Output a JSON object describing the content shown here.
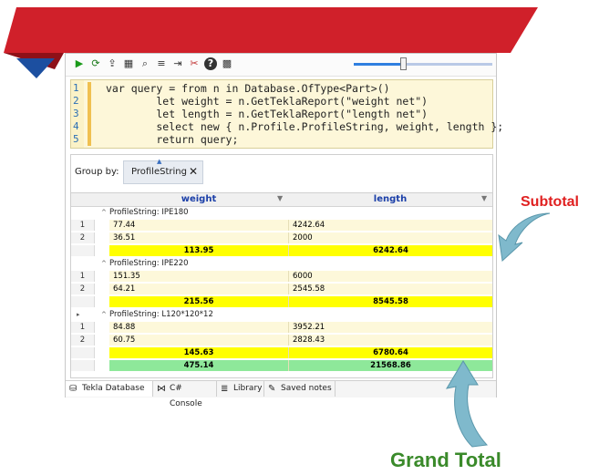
{
  "toolbar": {
    "icons": [
      "run-icon",
      "refresh-icon",
      "format-icon",
      "grid-icon",
      "connect-icon",
      "list-icon",
      "list-indent-icon",
      "clear-icon",
      "help-icon",
      "options-icon"
    ],
    "glyphs": [
      "▶",
      "⟳",
      "⇪",
      "▦",
      "⌕",
      "≡",
      "⇥",
      "✂",
      "?",
      "▩"
    ]
  },
  "editor": {
    "line_numbers": [
      "1",
      "2",
      "3",
      "4",
      "5"
    ],
    "lines": [
      "var query = from n in Database.OfType<Part>()",
      "        let weight = n.GetTeklaReport(\"weight net\")",
      "        let length = n.GetTeklaReport(\"length net\")",
      "        select new { n.Profile.ProfileString, weight, length };",
      "        return query;"
    ]
  },
  "groupby": {
    "label": "Group by:",
    "chip": "ProfileString",
    "remove": "✕"
  },
  "grid": {
    "columns": [
      "weight",
      "length"
    ],
    "groups": [
      {
        "title": "ProfileString: IPE180",
        "rows": [
          {
            "idx": "1",
            "weight": "77.44",
            "length": "4242.64"
          },
          {
            "idx": "2",
            "weight": "36.51",
            "length": "2000"
          }
        ],
        "subtotal": {
          "weight": "113.95",
          "length": "6242.64"
        }
      },
      {
        "title": "ProfileString: IPE220",
        "rows": [
          {
            "idx": "1",
            "weight": "151.35",
            "length": "6000"
          },
          {
            "idx": "2",
            "weight": "64.21",
            "length": "2545.58"
          }
        ],
        "subtotal": {
          "weight": "215.56",
          "length": "8545.58"
        }
      },
      {
        "title": "ProfileString: L120*120*12",
        "rows": [
          {
            "idx": "1",
            "weight": "84.88",
            "length": "3952.21"
          },
          {
            "idx": "2",
            "weight": "60.75",
            "length": "2828.43"
          }
        ],
        "subtotal": {
          "weight": "145.63",
          "length": "6780.64"
        }
      }
    ],
    "total": {
      "weight": "475.14",
      "length": "21568.86"
    }
  },
  "tabs": [
    {
      "label": "Tekla Database",
      "icon": "database-icon",
      "glyph": "⛁"
    },
    {
      "label": "C# Console",
      "icon": "console-icon",
      "glyph": "⋈"
    },
    {
      "label": "Library",
      "icon": "library-icon",
      "glyph": "≣"
    },
    {
      "label": "Saved notes",
      "icon": "notes-icon",
      "glyph": "✎"
    }
  ],
  "annotations": {
    "subtotal": "Subtotal",
    "grand_total": "Grand Total"
  },
  "colors": {
    "banner_red": "#d0202a",
    "banner_blue": "#1c4fa0",
    "subtotal_row": "#ffff00",
    "total_row": "#8ee89a",
    "arrow": "#7fb9cc"
  }
}
